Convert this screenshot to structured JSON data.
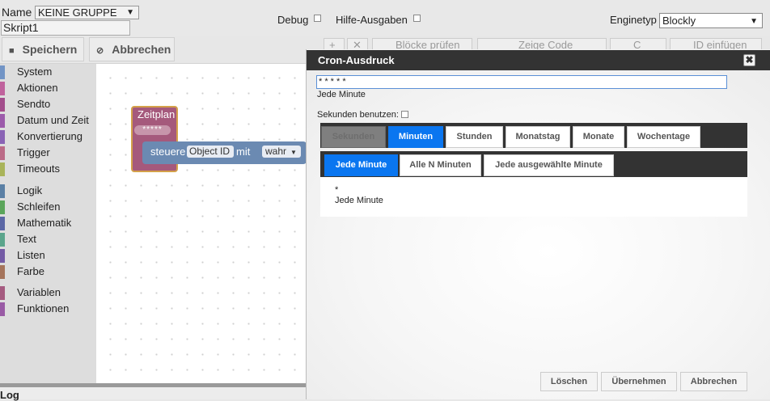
{
  "header": {
    "name_label": "Name",
    "group_value": "KEINE GRUPPE",
    "script_name": "Skript1",
    "debug_label": "Debug",
    "hilfe_label": "Hilfe-Ausgaben",
    "engine_label": "Enginetyp",
    "engine_value": "Blockly"
  },
  "toolbar": {
    "save_label": "Speichern",
    "cancel_label": "Abbrechen",
    "hidden": [
      "+",
      "✕",
      "Blöcke prüfen",
      "Zeige Code",
      "C",
      "ID einfügen"
    ]
  },
  "sidebar": {
    "items": [
      {
        "label": "System",
        "color": "#7294c5"
      },
      {
        "label": "Aktionen",
        "color": "#c0639d"
      },
      {
        "label": "Sendto",
        "color": "#a34e8c"
      },
      {
        "label": "Datum und Zeit",
        "color": "#9c5bab"
      },
      {
        "label": "Konvertierung",
        "color": "#8a63b5"
      },
      {
        "label": "Trigger",
        "color": "#bb6b87"
      },
      {
        "label": "Timeouts",
        "color": "#a9b45a"
      },
      {
        "label": "Logik",
        "color": "#5b80a5"
      },
      {
        "label": "Schleifen",
        "color": "#5ba55b"
      },
      {
        "label": "Mathematik",
        "color": "#5b67a5"
      },
      {
        "label": "Text",
        "color": "#5ba58c"
      },
      {
        "label": "Listen",
        "color": "#745ba5"
      },
      {
        "label": "Farbe",
        "color": "#a5745b"
      },
      {
        "label": "Variablen",
        "color": "#a55b80"
      },
      {
        "label": "Funktionen",
        "color": "#995ba5"
      }
    ]
  },
  "workspace": {
    "zeitplan_label": "Zeitplan",
    "zeitplan_cron": "*****",
    "steuere_label": "steuere",
    "objectid_label": "Object ID",
    "mit_label": "mit",
    "wahr_label": "wahr"
  },
  "log": {
    "label": "Log"
  },
  "dialog": {
    "title": "Cron-Ausdruck",
    "close_label": "✖",
    "cron_value": "* * * * *",
    "cron_description": "Jede Minute",
    "seconds_label": "Sekunden benutzen:",
    "tabs": [
      "Sekunden",
      "Minuten",
      "Stunden",
      "Monatstag",
      "Monate",
      "Wochentage"
    ],
    "subtabs": [
      "Jede Minute",
      "Alle N Minuten",
      "Jede ausgewählte Minute"
    ],
    "panel_value": "*",
    "panel_description": "Jede Minute",
    "buttons": {
      "delete": "Löschen",
      "apply": "Übernehmen",
      "cancel": "Abbrechen"
    }
  },
  "colors": {
    "accent": "#0a76f0",
    "dialog_header": "#333333"
  }
}
